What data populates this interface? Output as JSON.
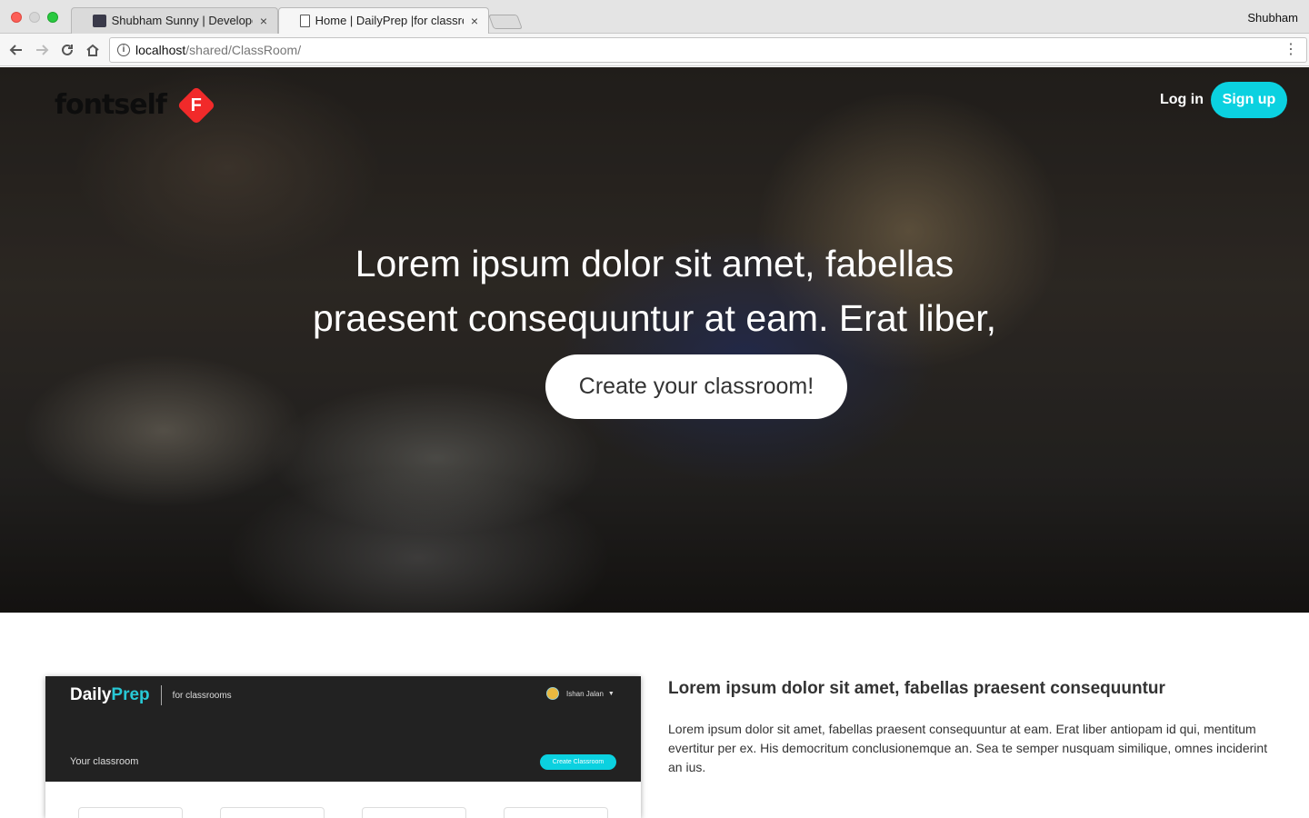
{
  "browser": {
    "tabs": [
      {
        "title": "Shubham Sunny | Developer | ",
        "close": "×"
      },
      {
        "title": "Home | DailyPrep |for classroo",
        "close": "×"
      }
    ],
    "profile": "Shubham",
    "url_host": "localhost",
    "url_path": "/shared/ClassRoom/",
    "menu_icon": "⋮"
  },
  "header": {
    "logo_text": "fontself",
    "logo_mark": "F",
    "login": "Log in",
    "signup": "Sign up"
  },
  "hero": {
    "heading": "Lorem ipsum dolor sit amet, fabellas praesent consequuntur at eam. Erat liber,",
    "cta": "Create your classroom!"
  },
  "preview": {
    "brand_daily": "Daily",
    "brand_prep": "Prep",
    "tagline": "for classrooms",
    "user": "Ishan Jalan",
    "section": "Your classroom",
    "create_button": "Create Classroom"
  },
  "feature": {
    "title": "Lorem ipsum dolor sit amet, fabellas praesent consequuntur",
    "text": "Lorem ipsum dolor sit amet, fabellas praesent consequuntur at eam. Erat liber antiopam id qui, mentitum evertitur per ex. His democritum conclusionemque an. Sea te semper nusquam similique, omnes inciderint an ius."
  },
  "colors": {
    "accent": "#0bd1e0",
    "logo_red": "#f12a2a"
  }
}
